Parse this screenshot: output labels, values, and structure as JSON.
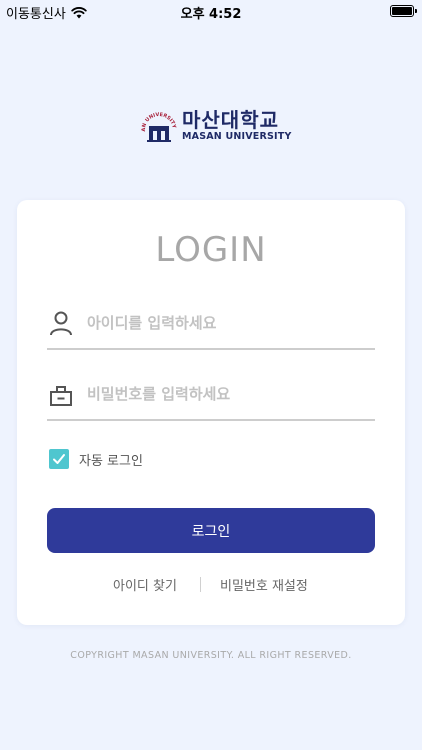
{
  "status_bar": {
    "carrier": "이동통신사",
    "time": "오후 4:52"
  },
  "logo": {
    "name_kr": "마산대학교",
    "name_en": "MASAN UNIVERSITY",
    "emblem_text": "MASAN UNIVERSITY 1966"
  },
  "login": {
    "title": "LOGIN",
    "id_placeholder": "아이디를 입력하세요",
    "password_placeholder": "비밀번호를 입력하세요",
    "auto_login_label": "자동 로그인",
    "auto_login_checked": true,
    "submit_label": "로그인",
    "find_id_label": "아이디 찾기",
    "reset_password_label": "비밀번호 재설정"
  },
  "footer": {
    "copyright": "COPYRIGHT MASAN UNIVERSITY. ALL RIGHT RESERVED."
  },
  "colors": {
    "background": "#eef3fe",
    "primary": "#2f3a9a",
    "checkbox": "#4fc6cf",
    "brand_navy": "#1f2a66",
    "brand_red": "#a8203a"
  },
  "icons": {
    "id_field": "user-icon",
    "password_field": "lock-icon",
    "checkbox": "check-icon"
  }
}
